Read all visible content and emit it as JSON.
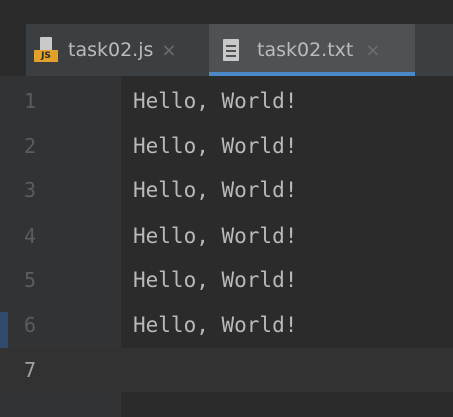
{
  "tabs": [
    {
      "label": "task02.js",
      "icon": "js-file-icon",
      "badge": "JS",
      "close": "×",
      "active": false
    },
    {
      "label": "task02.txt",
      "icon": "text-file-icon",
      "close": "×",
      "active": true
    }
  ],
  "editor": {
    "line_numbers": [
      "1",
      "2",
      "3",
      "4",
      "5",
      "6",
      "7"
    ],
    "lines": [
      "Hello, World!",
      "Hello, World!",
      "Hello, World!",
      "Hello, World!",
      "Hello, World!",
      "Hello, World!",
      ""
    ],
    "current_line": "7"
  },
  "colors": {
    "background": "#2b2b2b",
    "gutter": "#313335",
    "tabbar": "#3c3f41",
    "active_tab": "#4e5254",
    "active_tab_underline": "#4a88c7",
    "js_badge": "#e2a12a",
    "text": "#b9b9b9"
  }
}
